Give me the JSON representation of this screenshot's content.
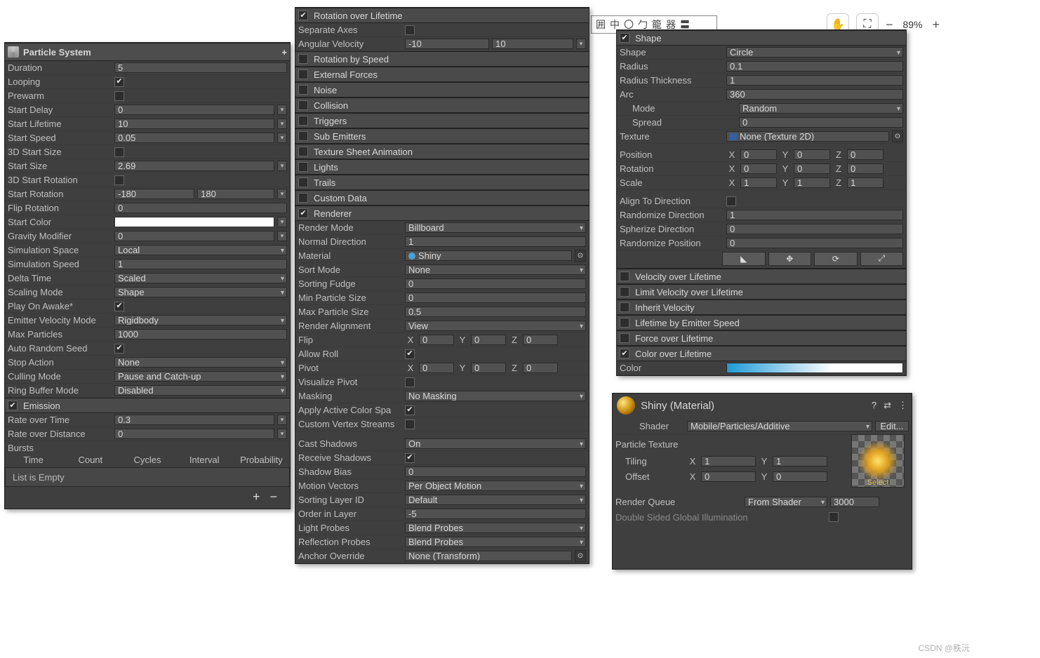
{
  "toolbar": {
    "ime_items": [
      "囲",
      "中",
      "〇",
      "勹",
      "籠",
      "器",
      "〓"
    ],
    "hand_icon": "hand-icon",
    "scan_icon": "scan-icon",
    "zoom_minus": "−",
    "zoom_value": "89%",
    "zoom_plus": "+"
  },
  "panel_ps": {
    "title": "Particle System",
    "add_btn": "+",
    "rows": [
      {
        "lbl": "Duration",
        "val": "5",
        "tail": false
      },
      {
        "lbl": "Looping",
        "chk": true
      },
      {
        "lbl": "Prewarm",
        "chk": false
      },
      {
        "lbl": "Start Delay",
        "val": "0",
        "tail": true
      },
      {
        "lbl": "Start Lifetime",
        "val": "10",
        "tail": true
      },
      {
        "lbl": "Start Speed",
        "val": "0.05",
        "tail": true
      },
      {
        "lbl": "3D Start Size",
        "chk": false
      },
      {
        "lbl": "Start Size",
        "val": "2.69",
        "tail": true
      },
      {
        "lbl": "3D Start Rotation",
        "chk": false
      },
      {
        "lbl": "Start Rotation",
        "val": "-180",
        "val2": "180",
        "tail": true
      },
      {
        "lbl": "Flip Rotation",
        "val": "0"
      },
      {
        "lbl": "Start Color",
        "color": "#ffffff",
        "tail": true
      },
      {
        "lbl": "Gravity Modifier",
        "val": "0",
        "tail": true
      },
      {
        "lbl": "Simulation Space",
        "dd": "Local"
      },
      {
        "lbl": "Simulation Speed",
        "val": "1"
      },
      {
        "lbl": "Delta Time",
        "dd": "Scaled"
      },
      {
        "lbl": "Scaling Mode",
        "dd": "Shape"
      },
      {
        "lbl": "Play On Awake*",
        "chk": true
      },
      {
        "lbl": "Emitter Velocity Mode",
        "dd": "Rigidbody"
      },
      {
        "lbl": "Max Particles",
        "val": "1000"
      },
      {
        "lbl": "Auto Random Seed",
        "chk": true
      },
      {
        "lbl": "Stop Action",
        "dd": "None"
      },
      {
        "lbl": "Culling Mode",
        "dd": "Pause and Catch-up"
      },
      {
        "lbl": "Ring Buffer Mode",
        "dd": "Disabled"
      }
    ],
    "emission": {
      "title": "Emission",
      "rate_time_lbl": "Rate over Time",
      "rate_time_val": "0.3",
      "rate_dist_lbl": "Rate over Distance",
      "rate_dist_val": "0",
      "bursts_lbl": "Bursts",
      "bursts_cols": [
        "Time",
        "Count",
        "Cycles",
        "Interval",
        "Probability"
      ],
      "empty": "List is Empty",
      "plus": "+",
      "minus": "−"
    }
  },
  "panel_mid": {
    "rot_over_life": {
      "chk": true,
      "title": "Rotation over Lifetime",
      "sep_axes_lbl": "Separate Axes",
      "sep_axes_chk": false,
      "ang_vel_lbl": "Angular Velocity",
      "ang_vel_a": "-10",
      "ang_vel_b": "10"
    },
    "modules": [
      {
        "chk": false,
        "lbl": "Rotation by Speed"
      },
      {
        "chk": false,
        "lbl": "External Forces"
      },
      {
        "chk": false,
        "lbl": "Noise"
      },
      {
        "chk": false,
        "lbl": "Collision"
      },
      {
        "chk": false,
        "lbl": "Triggers"
      },
      {
        "chk": false,
        "lbl": "Sub Emitters"
      },
      {
        "chk": false,
        "lbl": "Texture Sheet Animation"
      },
      {
        "chk": false,
        "lbl": "Lights"
      },
      {
        "chk": false,
        "lbl": "Trails"
      },
      {
        "chk": false,
        "lbl": "Custom Data"
      }
    ],
    "renderer": {
      "chk": true,
      "title": "Renderer",
      "rows": [
        {
          "lbl": "Render Mode",
          "dd": "Billboard"
        },
        {
          "lbl": "Normal Direction",
          "val": "1"
        },
        {
          "lbl": "Material",
          "obj": "Shiny",
          "dot": true
        },
        {
          "lbl": "Sort Mode",
          "dd": "None"
        },
        {
          "lbl": "Sorting Fudge",
          "val": "0"
        },
        {
          "lbl": "Min Particle Size",
          "val": "0"
        },
        {
          "lbl": "Max Particle Size",
          "val": "0.5"
        },
        {
          "lbl": "Render Alignment",
          "dd": "View"
        },
        {
          "lbl": "Flip",
          "xyz": [
            "0",
            "0",
            "0"
          ]
        },
        {
          "lbl": "Allow Roll",
          "chk": true
        },
        {
          "lbl": "Pivot",
          "xyz": [
            "0",
            "0",
            "0"
          ]
        },
        {
          "lbl": "Visualize Pivot",
          "chk": false
        },
        {
          "lbl": "Masking",
          "dd": "No Masking"
        },
        {
          "lbl": "Apply Active Color Spa",
          "chk": true,
          "ellipsis": true
        },
        {
          "lbl": "Custom Vertex Streams",
          "chk": false,
          "ellipsis": true
        },
        {
          "spacer": true
        },
        {
          "lbl": "Cast Shadows",
          "dd": "On"
        },
        {
          "lbl": "Receive Shadows",
          "chk": true
        },
        {
          "lbl": "Shadow Bias",
          "val": "0"
        },
        {
          "lbl": "Motion Vectors",
          "dd": "Per Object Motion"
        },
        {
          "lbl": "Sorting Layer ID",
          "dd": "Default"
        },
        {
          "lbl": "Order in Layer",
          "val": "-5"
        },
        {
          "lbl": "Light Probes",
          "dd": "Blend Probes"
        },
        {
          "lbl": "Reflection Probes",
          "dd": "Blend Probes"
        },
        {
          "lbl": "Anchor Override",
          "obj": "None (Transform)"
        }
      ]
    }
  },
  "panel_right": {
    "shape": {
      "chk": true,
      "title": "Shape",
      "rows": [
        {
          "lbl": "Shape",
          "dd": "Circle"
        },
        {
          "lbl": "Radius",
          "val": "0.1"
        },
        {
          "lbl": "Radius Thickness",
          "val": "1"
        },
        {
          "lbl": "Arc",
          "val": "360"
        },
        {
          "lbl": "Mode",
          "dd": "Random",
          "indent": true
        },
        {
          "lbl": "Spread",
          "val": "0",
          "indent": true
        },
        {
          "lbl": "Texture",
          "obj": "None (Texture 2D)",
          "tex": true
        }
      ],
      "xforms": [
        {
          "lbl": "Position",
          "x": "0",
          "y": "0",
          "z": "0"
        },
        {
          "lbl": "Rotation",
          "x": "0",
          "y": "0",
          "z": "0"
        },
        {
          "lbl": "Scale",
          "x": "1",
          "y": "1",
          "z": "1"
        }
      ],
      "rows2": [
        {
          "lbl": "Align To Direction",
          "chk": false
        },
        {
          "lbl": "Randomize Direction",
          "val": "1"
        },
        {
          "lbl": "Spherize Direction",
          "val": "0"
        },
        {
          "lbl": "Randomize Position",
          "val": "0"
        }
      ],
      "gizmos": [
        "◣",
        "✥",
        "⟳",
        "⤢"
      ]
    },
    "modules2": [
      {
        "chk": false,
        "lbl": "Velocity over Lifetime"
      },
      {
        "chk": false,
        "lbl": "Limit Velocity over Lifetime"
      },
      {
        "chk": false,
        "lbl": "Inherit Velocity"
      },
      {
        "chk": false,
        "lbl": "Lifetime by Emitter Speed"
      },
      {
        "chk": false,
        "lbl": "Force over Lifetime"
      },
      {
        "chk": true,
        "lbl": "Color over Lifetime"
      }
    ],
    "color_label": "Color"
  },
  "panel_mat": {
    "title": "Shiny (Material)",
    "help": "?",
    "preset": "⇄",
    "menu": "⋮",
    "shader_lbl": "Shader",
    "shader_val": "Mobile/Particles/Additive",
    "edit_btn": "Edit...",
    "ptex_lbl": "Particle Texture",
    "tiling_lbl": "Tiling",
    "tiling_x": "1",
    "tiling_y": "1",
    "offset_lbl": "Offset",
    "offset_x": "0",
    "offset_y": "0",
    "select_lbl": "Select",
    "rq_lbl": "Render Queue",
    "rq_mode": "From Shader",
    "rq_val": "3000",
    "dsgi_lbl": "Double Sided Global Illumination",
    "dsgi_chk": false
  },
  "footer": "CSDN @秩沅"
}
